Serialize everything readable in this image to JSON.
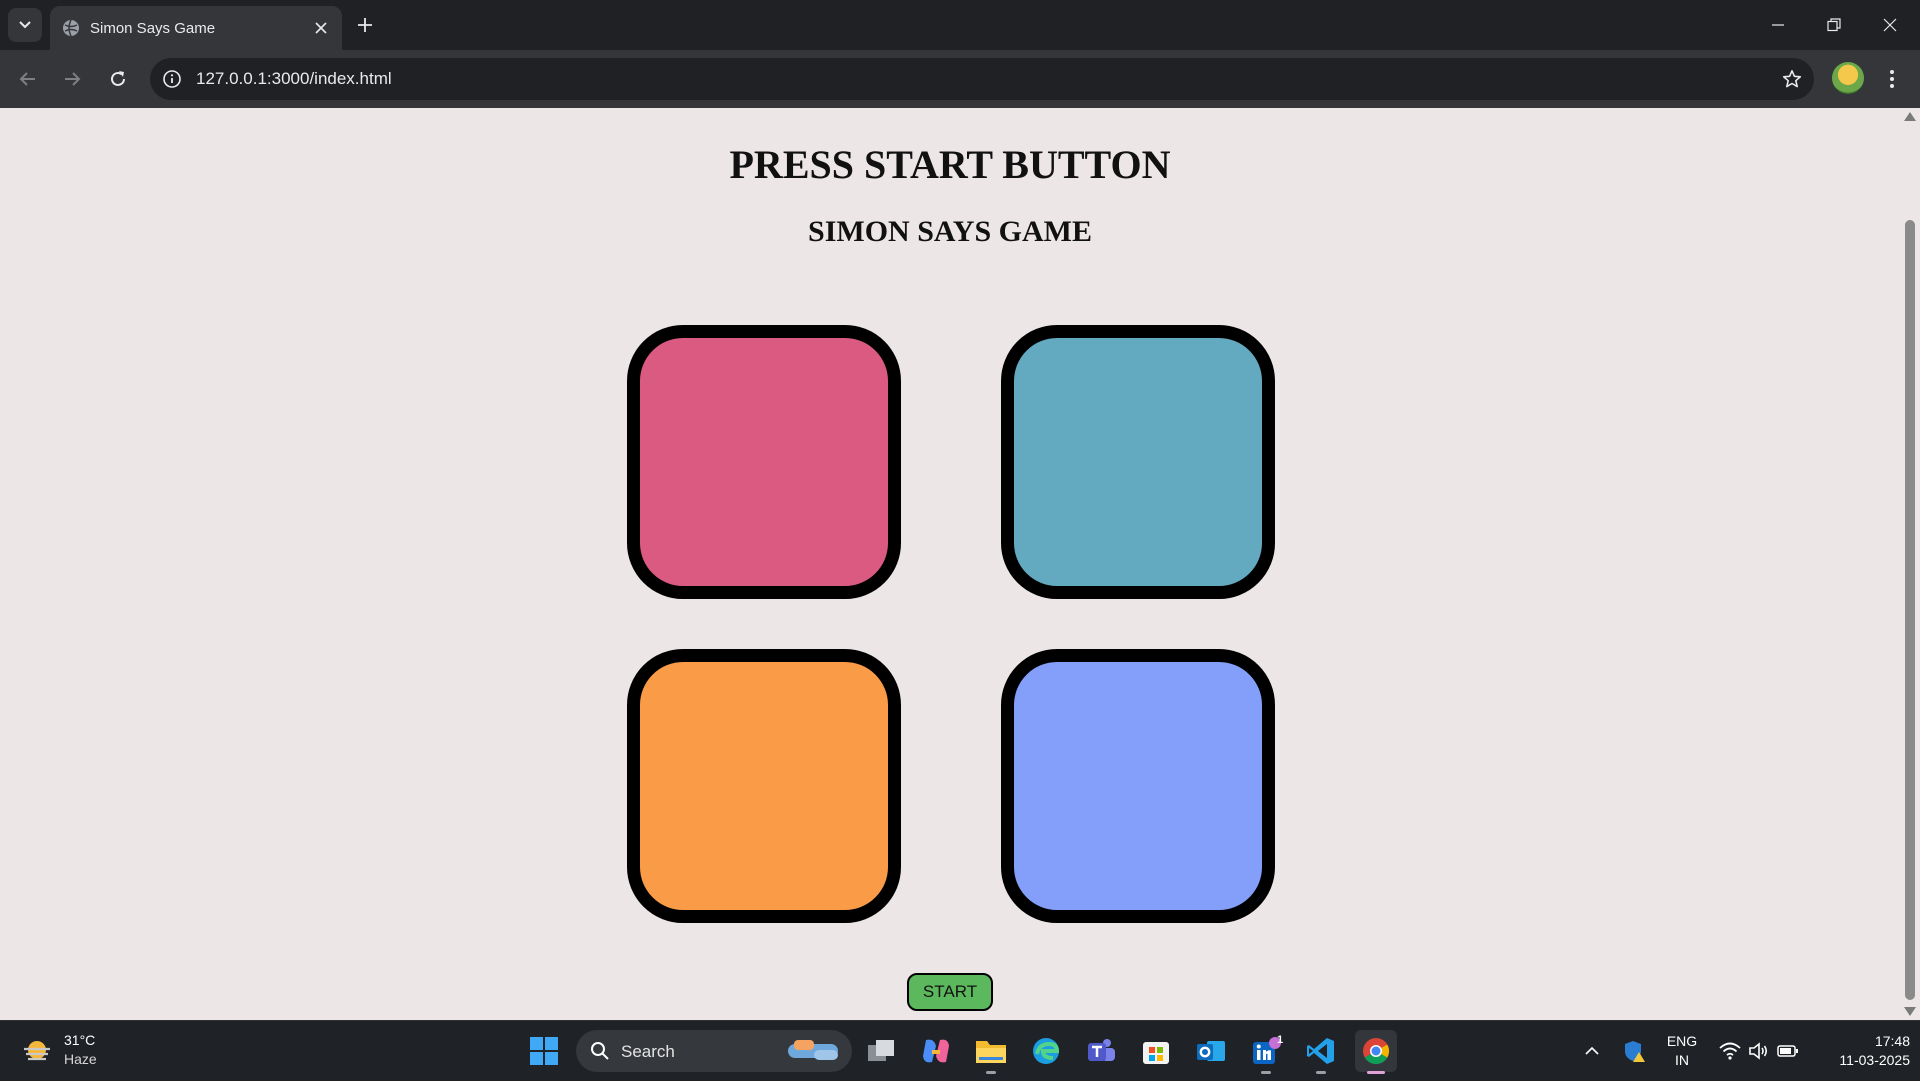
{
  "browser": {
    "tab_title": "Simon Says Game",
    "url": "127.0.0.1:3000/index.html"
  },
  "page": {
    "heading": "PRESS START BUTTON",
    "subheading": "SIMON SAYS GAME",
    "start_label": "START",
    "start_color": "#5cb85c",
    "pads": [
      {
        "name": "red",
        "color": "#db5a82"
      },
      {
        "name": "teal",
        "color": "#63aac1"
      },
      {
        "name": "orange",
        "color": "#f99b47"
      },
      {
        "name": "blue",
        "color": "#839ff9"
      }
    ]
  },
  "taskbar": {
    "weather_temp": "31°C",
    "weather_condition": "Haze",
    "search_placeholder": "Search",
    "linkedin_badge": "1",
    "lang_primary": "ENG",
    "lang_secondary": "IN",
    "time": "17:48",
    "date": "11-03-2025",
    "apps": [
      "start-menu",
      "search",
      "task-view",
      "copilot",
      "file-explorer",
      "edge",
      "teams",
      "microsoft-store",
      "outlook",
      "linkedin",
      "vscode",
      "chrome"
    ]
  }
}
